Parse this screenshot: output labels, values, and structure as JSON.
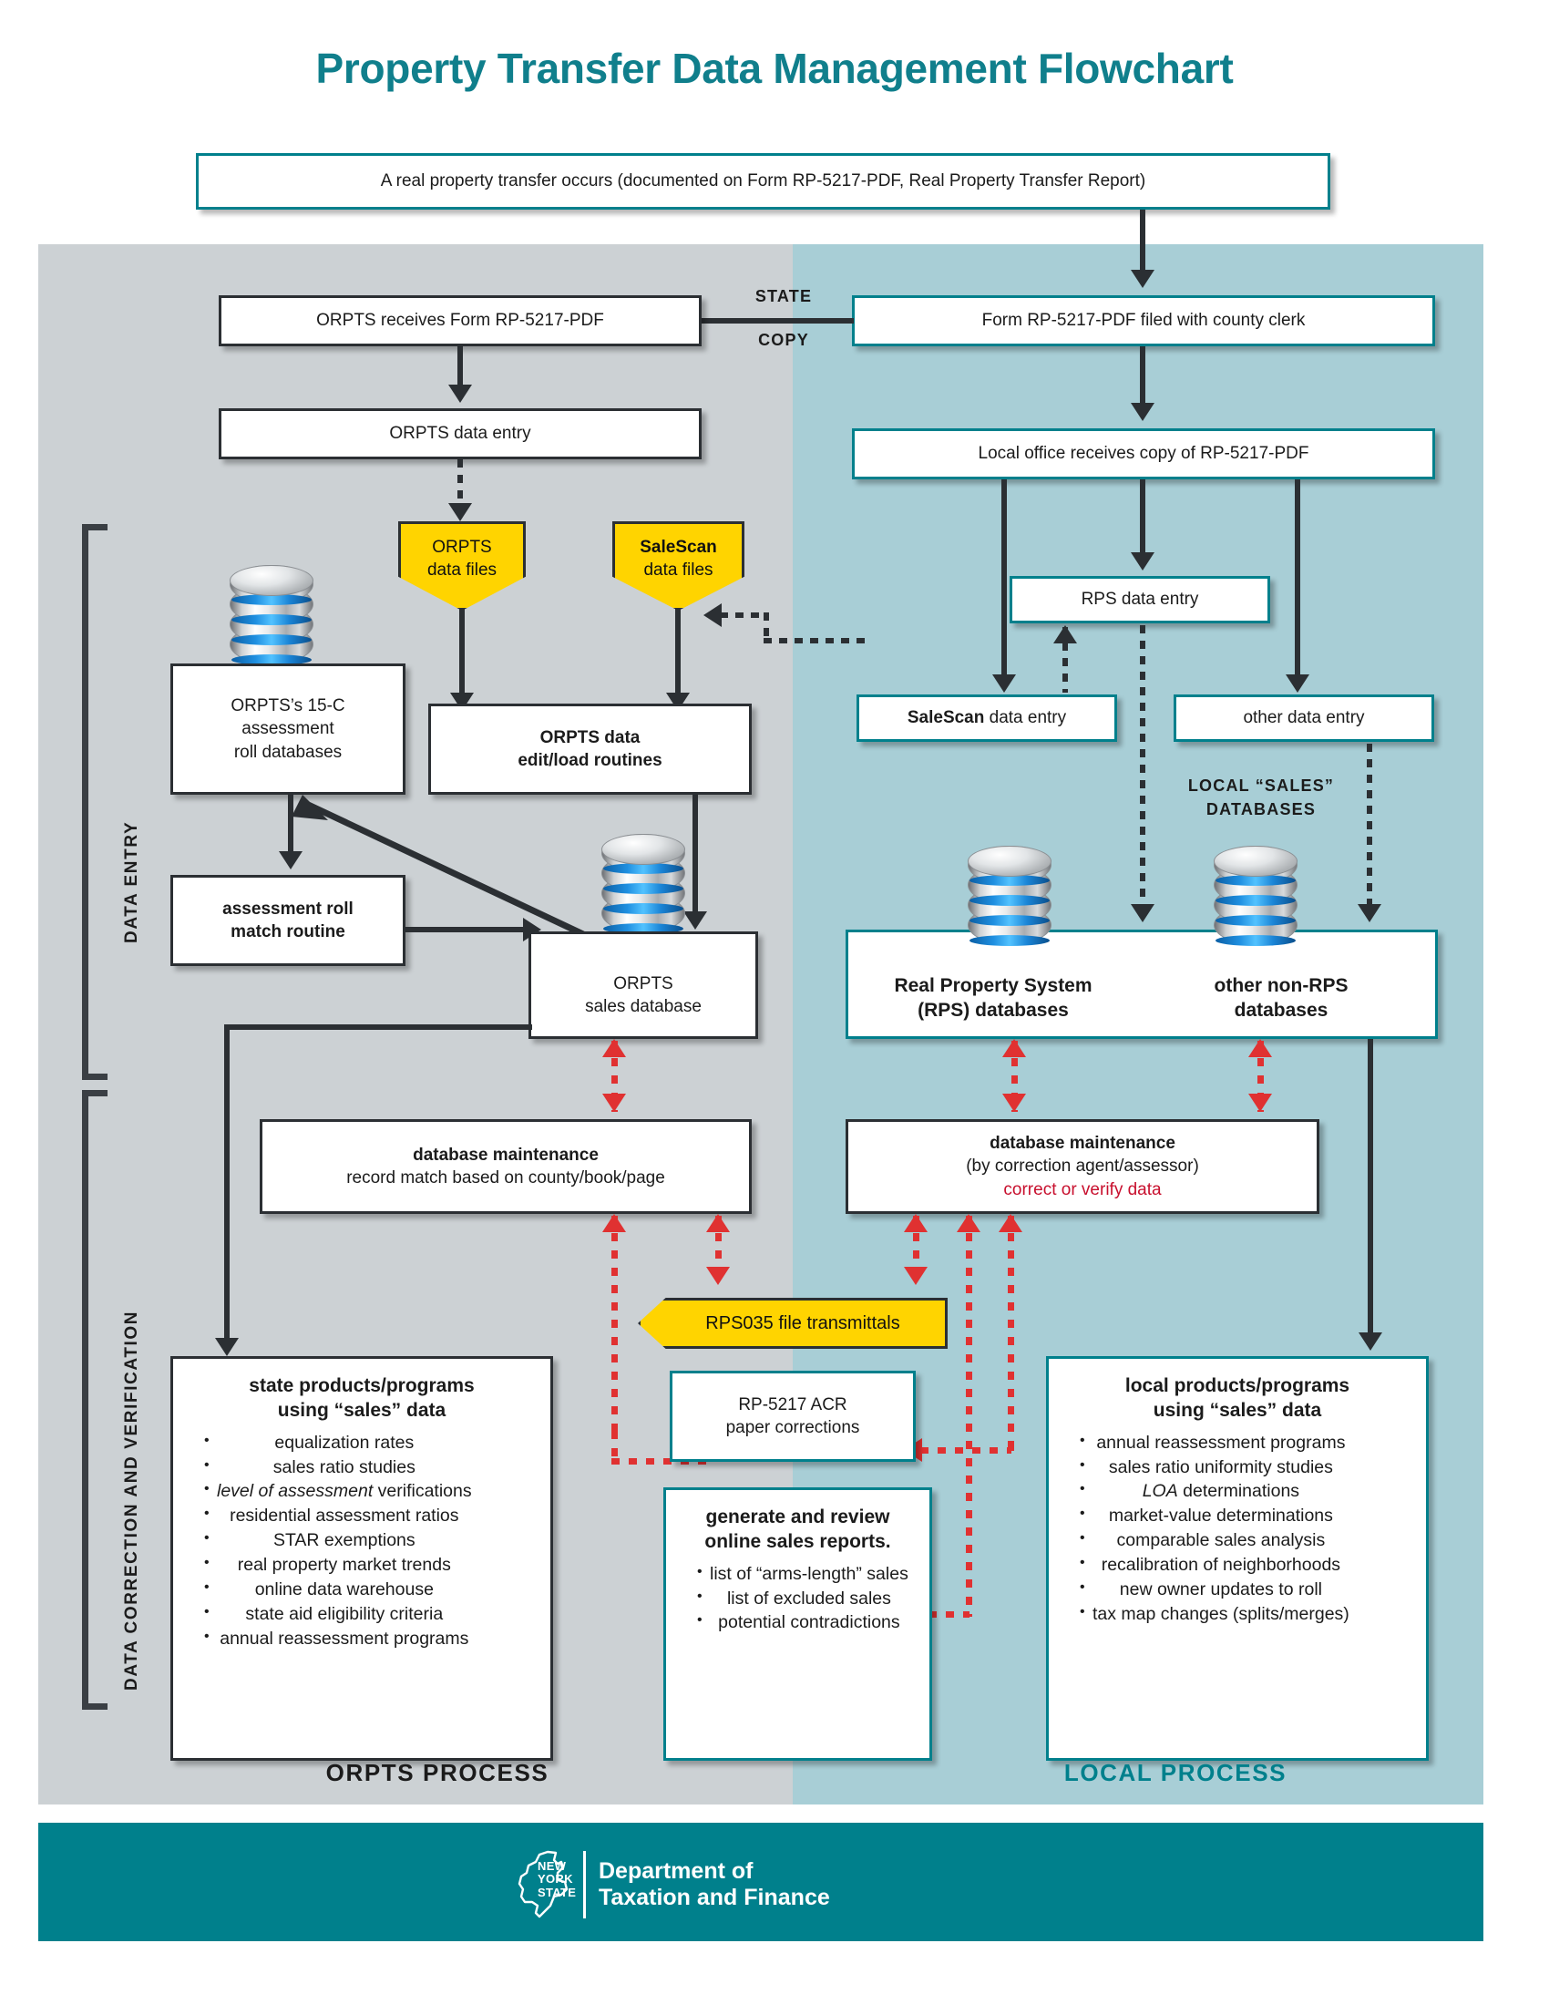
{
  "title": "Property Transfer Data Management Flowchart",
  "start": {
    "text": "A real property transfer occurs (documented on Form RP-5217-PDF, Real Property Transfer Report)"
  },
  "connector_labels": {
    "state": "STATE",
    "copy": "COPY",
    "local_sales_1": "LOCAL “SALES”",
    "local_sales_2": "DATABASES"
  },
  "side_labels": {
    "data_entry": "DATA ENTRY",
    "data_correction": "DATA CORRECTION AND VERIFICATION"
  },
  "process_labels": {
    "orpts": "ORPTS PROCESS",
    "local": "LOCAL PROCESS"
  },
  "orpts": {
    "receives": "ORPTS receives Form RP-5217-PDF",
    "data_entry": "ORPTS data entry",
    "data_files": {
      "line1": "ORPTS",
      "line2": "data files"
    },
    "salescan_files": {
      "line1": "SaleScan",
      "line2": "data files"
    },
    "assessment_roll_db": {
      "line1": "ORPTS’s 15-C",
      "line2": "assessment",
      "line3": "roll databases"
    },
    "edit_load": {
      "line1": "ORPTS data",
      "line2": "edit/load routines"
    },
    "match_routine": {
      "line1": "assessment roll",
      "line2": "match routine"
    },
    "sales_database": {
      "line1": "ORPTS",
      "line2": "sales database"
    },
    "db_maintenance": {
      "line1": "database maintenance",
      "line2": "record match based on county/book/page"
    },
    "products": {
      "heading1": "state products/programs",
      "heading2": "using “sales” data",
      "items": [
        {
          "text": "equalization rates",
          "italic": false
        },
        {
          "text": "sales ratio studies",
          "italic": false
        },
        {
          "text": "level of assessment",
          "italic": true,
          "suffix": " verifications"
        },
        {
          "text": "residential assessment ratios",
          "italic": false
        },
        {
          "text": "STAR exemptions",
          "italic": false
        },
        {
          "text": "real property market trends",
          "italic": false
        },
        {
          "text": "online data warehouse",
          "italic": false
        },
        {
          "text": "state aid eligibility criteria",
          "italic": false
        },
        {
          "text": "annual reassessment programs",
          "italic": false
        }
      ]
    }
  },
  "local": {
    "filed": "Form RP-5217-PDF filed with county clerk",
    "office_receives": "Local office receives copy of RP-5217-PDF",
    "rps_data_entry": "RPS data entry",
    "salescan_data_entry_bold": "SaleScan",
    "salescan_data_entry_rest": " data entry",
    "other_data_entry": "other data entry",
    "rps_databases": {
      "line1": "Real Property System",
      "line2": "(RPS) databases"
    },
    "non_rps_databases": {
      "line1": "other non-RPS",
      "line2": "databases"
    },
    "db_maintenance": {
      "line1": "database maintenance",
      "line2": "(by correction agent/assessor)",
      "line3": "correct or verify data"
    },
    "products": {
      "heading1": "local products/programs",
      "heading2": "using “sales” data",
      "items": [
        {
          "text": "annual reassessment programs",
          "italic": false
        },
        {
          "text": "sales ratio uniformity studies",
          "italic": false
        },
        {
          "text": "LOA",
          "italic": true,
          "suffix": " determinations"
        },
        {
          "text": "market-value determinations",
          "italic": false
        },
        {
          "text": "comparable sales analysis",
          "italic": false
        },
        {
          "text": "recalibration of neighborhoods",
          "italic": false
        },
        {
          "text": "new owner updates to roll",
          "italic": false
        },
        {
          "text": "tax map changes (splits/merges)",
          "italic": false
        }
      ]
    }
  },
  "middle": {
    "rps035": "RPS035 file transmittals",
    "acr": {
      "line1": "RP-5217 ACR",
      "line2": "paper corrections"
    },
    "online_reports": {
      "heading1": "generate and review",
      "heading2": "online sales reports.",
      "items": [
        "list of “arms-length” sales",
        "list of excluded sales",
        "potential contradictions"
      ]
    }
  },
  "footer": {
    "state_line1": "NEW",
    "state_line2": "YORK",
    "state_line3": "STATE",
    "dept_line1": "Department of",
    "dept_line2": "Taxation and Finance"
  },
  "colors": {
    "brand_teal": "#00808c",
    "title_teal": "#107f8c",
    "panel_left": "#ccd1d4",
    "panel_right": "#a8ced6",
    "yellow": "#ffd400",
    "red": "#e03131",
    "red_text": "#c8102e",
    "dark": "#2b2f33"
  }
}
